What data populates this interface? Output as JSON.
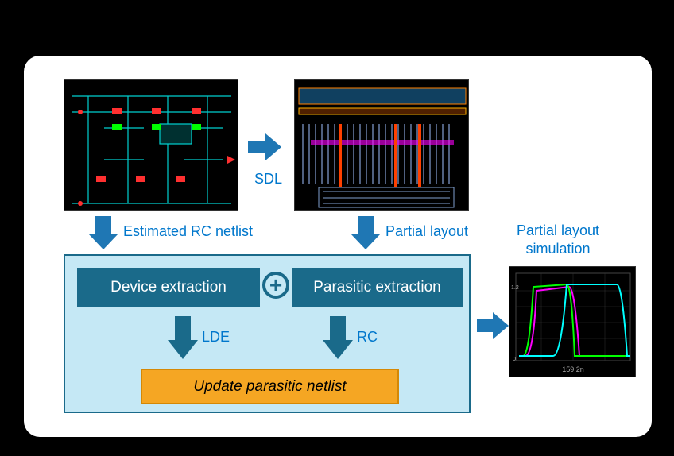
{
  "diagram": {
    "labels": {
      "sdl": "SDL",
      "estimated_rc": "Estimated RC netlist",
      "partial_layout": "Partial layout",
      "partial_sim_line1": "Partial layout",
      "partial_sim_line2": "simulation",
      "device_extraction": "Device extraction",
      "parasitic_extraction": "Parasitic extraction",
      "lde": "LDE",
      "rc": "RC",
      "update": "Update parasitic netlist",
      "plus": "+"
    },
    "sim_plot": {
      "x_axis_label": "159.2n",
      "y_range": [
        0,
        1.2
      ],
      "curves": [
        {
          "color": "#ff00ff",
          "desc": "rise-fall waveform"
        },
        {
          "color": "#00ff00",
          "desc": "rise-fall waveform shifted"
        },
        {
          "color": "#00ffff",
          "desc": "delayed rise-fall waveform"
        }
      ]
    },
    "colors": {
      "accent_blue": "#0077cc",
      "panel_teal": "#1a6a8a",
      "panel_light": "#c5e8f5",
      "orange": "#f5a623"
    }
  }
}
